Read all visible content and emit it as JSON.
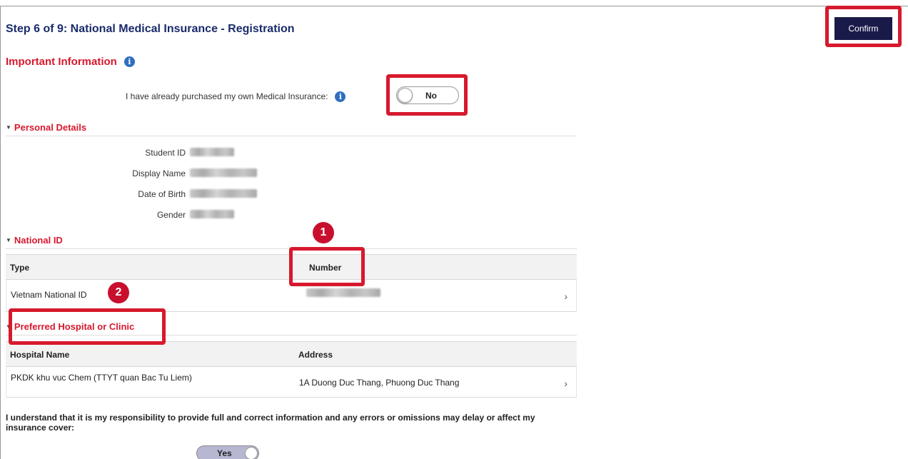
{
  "header": {
    "title": "Step 6 of 9: National Medical Insurance - Registration",
    "confirm_label": "Confirm"
  },
  "important": {
    "title": "Important Information",
    "info_icon": "i",
    "purchased_label": "I have already purchased my own Medical Insurance:",
    "purchased_toggle": "No"
  },
  "personal": {
    "title": "Personal Details",
    "fields": [
      {
        "label": "Student ID"
      },
      {
        "label": "Display Name"
      },
      {
        "label": "Date of Birth"
      },
      {
        "label": "Gender"
      }
    ]
  },
  "national_id": {
    "title": "National ID",
    "columns": [
      "Type",
      "Number"
    ],
    "rows": [
      {
        "type": "Vietnam National ID"
      }
    ]
  },
  "hospital": {
    "title": "Preferred Hospital or Clinic",
    "columns": [
      "Hospital Name",
      "Address"
    ],
    "rows": [
      {
        "name": "PKDK khu vuc Chem (TTYT quan Bac Tu Liem)",
        "address": "1A Duong Duc Thang, Phuong Duc Thang"
      }
    ]
  },
  "acknowledgement": {
    "text": "I understand that it is my responsibility to provide full and correct information and any errors or omissions may delay or affect my insurance cover:",
    "toggle": "Yes"
  },
  "annotations": {
    "badge_1": "1",
    "badge_2": "2"
  },
  "icons": {
    "section_caret": "caret-down-icon",
    "row_chevron": "chevron-right-icon",
    "info": "info-icon"
  },
  "colors": {
    "accent_red": "#d7192d",
    "title_blue": "#1a2b6b",
    "confirm_bg": "#1a1a4a",
    "info_blue": "#2f6ec1"
  }
}
